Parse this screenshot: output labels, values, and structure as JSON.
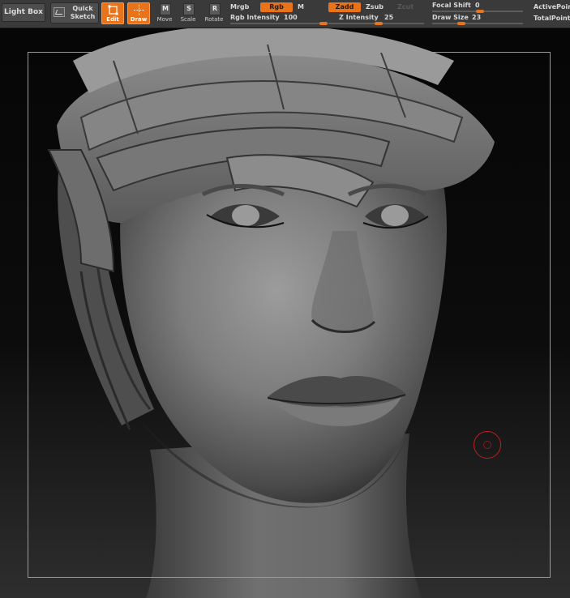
{
  "toolbar": {
    "light_box": "Light Box",
    "quick_sketch_line1": "Quick",
    "quick_sketch_line2": "Sketch",
    "edit": "Edit",
    "draw": "Draw",
    "move": "Move",
    "scale": "Scale",
    "rotate": "Rotate",
    "mrgb": "Mrgb",
    "rgb": "Rgb",
    "m": "M",
    "zadd": "Zadd",
    "zsub": "Zsub",
    "zcut": "Zcut",
    "rgb_intensity_label": "Rgb Intensity",
    "rgb_intensity_value": "100",
    "z_intensity_label": "Z Intensity",
    "z_intensity_value": "25",
    "focal_shift_label": "Focal Shift",
    "focal_shift_value": "0",
    "draw_size_label": "Draw Size",
    "draw_size_value": "23",
    "active_points": "ActivePoin",
    "total_points": "TotalPoint"
  },
  "icons": {
    "move_letter": "M",
    "scale_letter": "S",
    "rotate_letter": "R"
  },
  "colors": {
    "accent": "#e8731b",
    "toolbar": "#3a3a3a",
    "cursor": "#c41d1d"
  }
}
